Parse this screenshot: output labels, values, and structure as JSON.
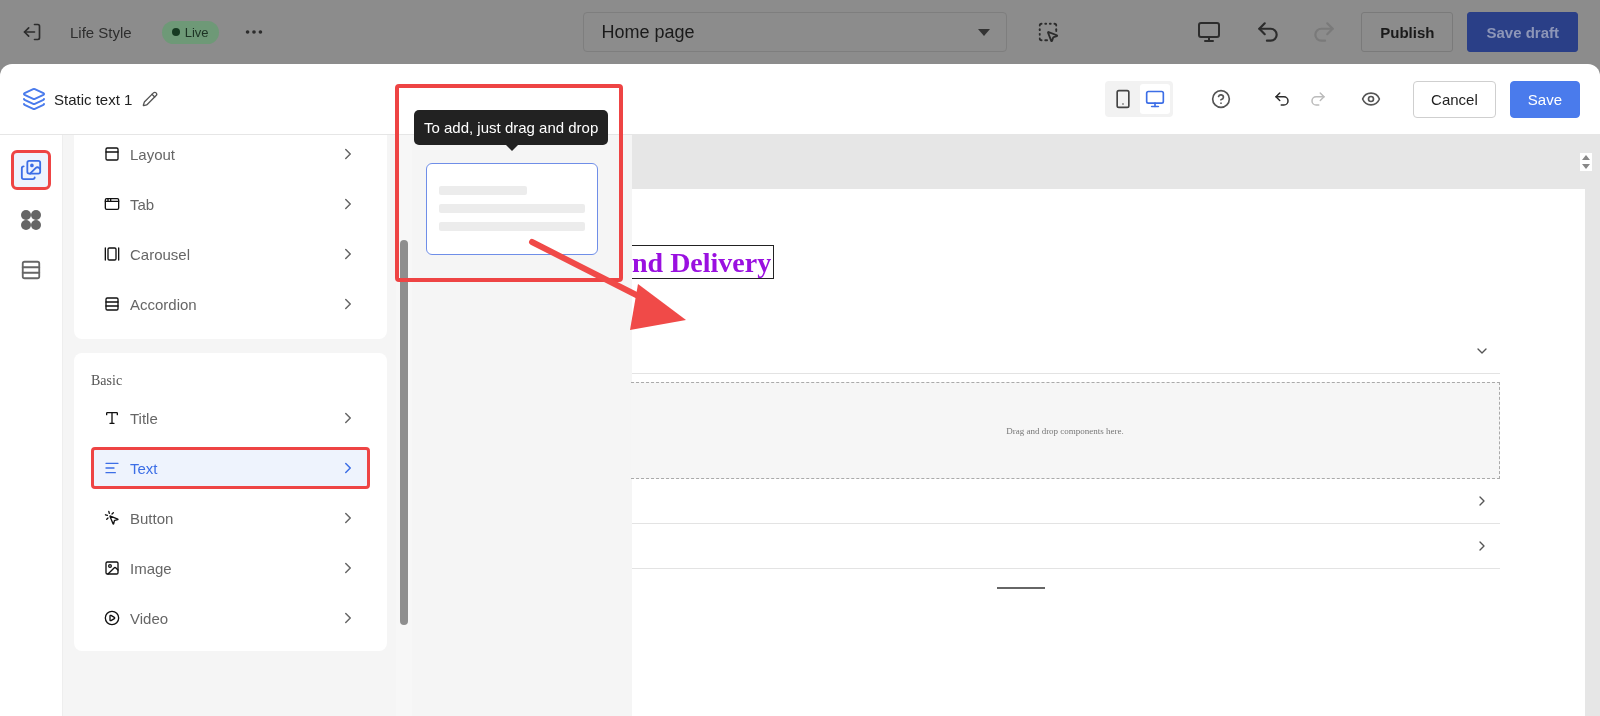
{
  "top_bar": {
    "site_name": "Life Style",
    "status": "Live",
    "page_select": "Home page",
    "buttons": [
      {
        "label": "Publish",
        "kind": "outline"
      },
      {
        "label": "Save draft",
        "kind": "primary"
      }
    ]
  },
  "editor": {
    "title": "Static text 1",
    "device": [
      {
        "kind": "mobile",
        "selected": false
      },
      {
        "kind": "desktop",
        "selected": true
      }
    ],
    "buttons": [
      {
        "label": "Cancel",
        "kind": "outline"
      },
      {
        "label": "Save",
        "kind": "primary"
      }
    ]
  },
  "rail": [
    {
      "kind": "components",
      "selected": true
    },
    {
      "kind": "apps",
      "selected": false
    },
    {
      "kind": "sections",
      "selected": false
    }
  ],
  "component_groups": [
    {
      "items": [
        {
          "label": "Layout",
          "kind": "layout",
          "selected": false
        },
        {
          "label": "Tab",
          "kind": "tab",
          "selected": false
        },
        {
          "label": "Carousel",
          "kind": "carousel",
          "selected": false
        },
        {
          "label": "Accordion",
          "kind": "accordion",
          "selected": false
        }
      ]
    },
    {
      "heading": "Basic",
      "items": [
        {
          "label": "Title",
          "kind": "title",
          "selected": false
        },
        {
          "label": "Text",
          "kind": "text",
          "selected": true
        },
        {
          "label": "Button",
          "kind": "button",
          "selected": false
        },
        {
          "label": "Image",
          "kind": "image",
          "selected": false
        },
        {
          "label": "Video",
          "kind": "video",
          "selected": false
        }
      ]
    }
  ],
  "preview": {
    "tooltip": "To add, just drag and drop"
  },
  "canvas": {
    "heading": "nd Delivery",
    "dropzone": "Drag and drop components here.",
    "accordion": [
      {
        "expanded": true
      },
      {
        "expanded": false
      },
      {
        "expanded": false
      }
    ]
  }
}
